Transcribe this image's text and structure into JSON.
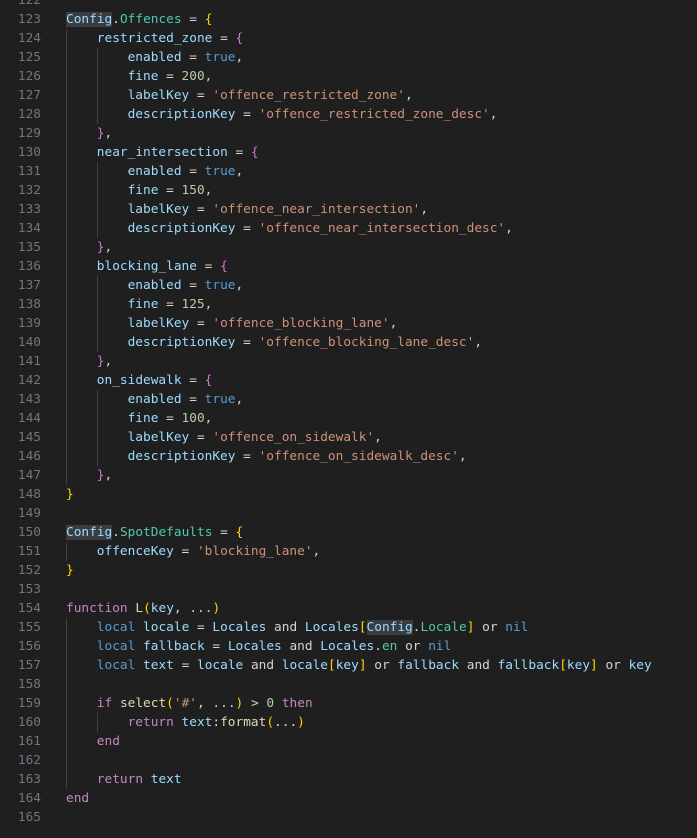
{
  "editor": {
    "language": "lua",
    "lines": [
      {
        "n": "122",
        "indent": 0,
        "tokens": []
      },
      {
        "n": "123",
        "indent": 0,
        "tokens": [
          [
            "vh",
            "Config"
          ],
          [
            "o",
            "."
          ],
          [
            "p",
            "Offences"
          ],
          [
            "o",
            " = "
          ],
          [
            "b1",
            "{"
          ]
        ]
      },
      {
        "n": "124",
        "indent": 1,
        "tokens": [
          [
            "v",
            "restricted_zone"
          ],
          [
            "o",
            " = "
          ],
          [
            "b2",
            "{"
          ]
        ]
      },
      {
        "n": "125",
        "indent": 2,
        "tokens": [
          [
            "v",
            "enabled"
          ],
          [
            "o",
            " = "
          ],
          [
            "k",
            "true"
          ],
          [
            "o",
            ","
          ]
        ]
      },
      {
        "n": "126",
        "indent": 2,
        "tokens": [
          [
            "v",
            "fine"
          ],
          [
            "o",
            " = "
          ],
          [
            "num",
            "200"
          ],
          [
            "o",
            ","
          ]
        ]
      },
      {
        "n": "127",
        "indent": 2,
        "tokens": [
          [
            "v",
            "labelKey"
          ],
          [
            "o",
            " = "
          ],
          [
            "s",
            "'offence_restricted_zone'"
          ],
          [
            "o",
            ","
          ]
        ]
      },
      {
        "n": "128",
        "indent": 2,
        "tokens": [
          [
            "v",
            "descriptionKey"
          ],
          [
            "o",
            " = "
          ],
          [
            "s",
            "'offence_restricted_zone_desc'"
          ],
          [
            "o",
            ","
          ]
        ]
      },
      {
        "n": "129",
        "indent": 1,
        "tokens": [
          [
            "b2",
            "}"
          ],
          [
            "o",
            ","
          ]
        ]
      },
      {
        "n": "130",
        "indent": 1,
        "tokens": [
          [
            "v",
            "near_intersection"
          ],
          [
            "o",
            " = "
          ],
          [
            "b2",
            "{"
          ]
        ]
      },
      {
        "n": "131",
        "indent": 2,
        "tokens": [
          [
            "v",
            "enabled"
          ],
          [
            "o",
            " = "
          ],
          [
            "k",
            "true"
          ],
          [
            "o",
            ","
          ]
        ]
      },
      {
        "n": "132",
        "indent": 2,
        "tokens": [
          [
            "v",
            "fine"
          ],
          [
            "o",
            " = "
          ],
          [
            "num",
            "150"
          ],
          [
            "o",
            ","
          ]
        ]
      },
      {
        "n": "133",
        "indent": 2,
        "tokens": [
          [
            "v",
            "labelKey"
          ],
          [
            "o",
            " = "
          ],
          [
            "s",
            "'offence_near_intersection'"
          ],
          [
            "o",
            ","
          ]
        ]
      },
      {
        "n": "134",
        "indent": 2,
        "tokens": [
          [
            "v",
            "descriptionKey"
          ],
          [
            "o",
            " = "
          ],
          [
            "s",
            "'offence_near_intersection_desc'"
          ],
          [
            "o",
            ","
          ]
        ]
      },
      {
        "n": "135",
        "indent": 1,
        "tokens": [
          [
            "b2",
            "}"
          ],
          [
            "o",
            ","
          ]
        ]
      },
      {
        "n": "136",
        "indent": 1,
        "tokens": [
          [
            "v",
            "blocking_lane"
          ],
          [
            "o",
            " = "
          ],
          [
            "b2",
            "{"
          ]
        ]
      },
      {
        "n": "137",
        "indent": 2,
        "tokens": [
          [
            "v",
            "enabled"
          ],
          [
            "o",
            " = "
          ],
          [
            "k",
            "true"
          ],
          [
            "o",
            ","
          ]
        ]
      },
      {
        "n": "138",
        "indent": 2,
        "tokens": [
          [
            "v",
            "fine"
          ],
          [
            "o",
            " = "
          ],
          [
            "num",
            "125"
          ],
          [
            "o",
            ","
          ]
        ]
      },
      {
        "n": "139",
        "indent": 2,
        "tokens": [
          [
            "v",
            "labelKey"
          ],
          [
            "o",
            " = "
          ],
          [
            "s",
            "'offence_blocking_lane'"
          ],
          [
            "o",
            ","
          ]
        ]
      },
      {
        "n": "140",
        "indent": 2,
        "tokens": [
          [
            "v",
            "descriptionKey"
          ],
          [
            "o",
            " = "
          ],
          [
            "s",
            "'offence_blocking_lane_desc'"
          ],
          [
            "o",
            ","
          ]
        ]
      },
      {
        "n": "141",
        "indent": 1,
        "tokens": [
          [
            "b2",
            "}"
          ],
          [
            "o",
            ","
          ]
        ]
      },
      {
        "n": "142",
        "indent": 1,
        "tokens": [
          [
            "v",
            "on_sidewalk"
          ],
          [
            "o",
            " = "
          ],
          [
            "b2",
            "{"
          ]
        ]
      },
      {
        "n": "143",
        "indent": 2,
        "tokens": [
          [
            "v",
            "enabled"
          ],
          [
            "o",
            " = "
          ],
          [
            "k",
            "true"
          ],
          [
            "o",
            ","
          ]
        ]
      },
      {
        "n": "144",
        "indent": 2,
        "tokens": [
          [
            "v",
            "fine"
          ],
          [
            "o",
            " = "
          ],
          [
            "num",
            "100"
          ],
          [
            "o",
            ","
          ]
        ]
      },
      {
        "n": "145",
        "indent": 2,
        "tokens": [
          [
            "v",
            "labelKey"
          ],
          [
            "o",
            " = "
          ],
          [
            "s",
            "'offence_on_sidewalk'"
          ],
          [
            "o",
            ","
          ]
        ]
      },
      {
        "n": "146",
        "indent": 2,
        "tokens": [
          [
            "v",
            "descriptionKey"
          ],
          [
            "o",
            " = "
          ],
          [
            "s",
            "'offence_on_sidewalk_desc'"
          ],
          [
            "o",
            ","
          ]
        ]
      },
      {
        "n": "147",
        "indent": 1,
        "tokens": [
          [
            "b2",
            "}"
          ],
          [
            "o",
            ","
          ]
        ]
      },
      {
        "n": "148",
        "indent": 0,
        "tokens": [
          [
            "b1",
            "}"
          ]
        ]
      },
      {
        "n": "149",
        "indent": 0,
        "tokens": []
      },
      {
        "n": "150",
        "indent": 0,
        "tokens": [
          [
            "vh",
            "Config"
          ],
          [
            "o",
            "."
          ],
          [
            "p",
            "SpotDefaults"
          ],
          [
            "o",
            " = "
          ],
          [
            "b1",
            "{"
          ]
        ]
      },
      {
        "n": "151",
        "indent": 1,
        "tokens": [
          [
            "v",
            "offenceKey"
          ],
          [
            "o",
            " = "
          ],
          [
            "s",
            "'blocking_lane'"
          ],
          [
            "o",
            ","
          ]
        ]
      },
      {
        "n": "152",
        "indent": 0,
        "tokens": [
          [
            "b1",
            "}"
          ]
        ]
      },
      {
        "n": "153",
        "indent": 0,
        "tokens": []
      },
      {
        "n": "154",
        "indent": 0,
        "tokens": [
          [
            "c",
            "function"
          ],
          [
            "o",
            " "
          ],
          [
            "f",
            "L"
          ],
          [
            "b1",
            "("
          ],
          [
            "v",
            "key"
          ],
          [
            "o",
            ", ..."
          ],
          [
            "b1",
            ")"
          ]
        ]
      },
      {
        "n": "155",
        "indent": 1,
        "tokens": [
          [
            "k",
            "local"
          ],
          [
            "o",
            " "
          ],
          [
            "v",
            "locale"
          ],
          [
            "o",
            " = "
          ],
          [
            "v",
            "Locales"
          ],
          [
            "o",
            " and "
          ],
          [
            "v",
            "Locales"
          ],
          [
            "b1",
            "["
          ],
          [
            "vh",
            "Config"
          ],
          [
            "o",
            "."
          ],
          [
            "p",
            "Locale"
          ],
          [
            "b1",
            "]"
          ],
          [
            "o",
            " or "
          ],
          [
            "k",
            "nil"
          ]
        ]
      },
      {
        "n": "156",
        "indent": 1,
        "tokens": [
          [
            "k",
            "local"
          ],
          [
            "o",
            " "
          ],
          [
            "v",
            "fallback"
          ],
          [
            "o",
            " = "
          ],
          [
            "v",
            "Locales"
          ],
          [
            "o",
            " and "
          ],
          [
            "v",
            "Locales"
          ],
          [
            "o",
            "."
          ],
          [
            "p",
            "en"
          ],
          [
            "o",
            " or "
          ],
          [
            "k",
            "nil"
          ]
        ]
      },
      {
        "n": "157",
        "indent": 1,
        "tokens": [
          [
            "k",
            "local"
          ],
          [
            "o",
            " "
          ],
          [
            "v",
            "text"
          ],
          [
            "o",
            " = "
          ],
          [
            "v",
            "locale"
          ],
          [
            "o",
            " and "
          ],
          [
            "v",
            "locale"
          ],
          [
            "b1",
            "["
          ],
          [
            "v",
            "key"
          ],
          [
            "b1",
            "]"
          ],
          [
            "o",
            " or "
          ],
          [
            "v",
            "fallback"
          ],
          [
            "o",
            " and "
          ],
          [
            "v",
            "fallback"
          ],
          [
            "b1",
            "["
          ],
          [
            "v",
            "key"
          ],
          [
            "b1",
            "]"
          ],
          [
            "o",
            " or "
          ],
          [
            "v",
            "key"
          ]
        ]
      },
      {
        "n": "158",
        "indent": 1,
        "tokens": []
      },
      {
        "n": "159",
        "indent": 1,
        "tokens": [
          [
            "c",
            "if"
          ],
          [
            "o",
            " "
          ],
          [
            "f",
            "select"
          ],
          [
            "b1",
            "("
          ],
          [
            "s",
            "'#'"
          ],
          [
            "o",
            ", ..."
          ],
          [
            "b1",
            ")"
          ],
          [
            "o",
            " > "
          ],
          [
            "num",
            "0"
          ],
          [
            "o",
            " "
          ],
          [
            "c",
            "then"
          ]
        ]
      },
      {
        "n": "160",
        "indent": 2,
        "tokens": [
          [
            "c",
            "return"
          ],
          [
            "o",
            " "
          ],
          [
            "v",
            "text"
          ],
          [
            "o",
            ":"
          ],
          [
            "f",
            "format"
          ],
          [
            "b1",
            "("
          ],
          [
            "o",
            "..."
          ],
          [
            "b1",
            ")"
          ]
        ]
      },
      {
        "n": "161",
        "indent": 1,
        "tokens": [
          [
            "c",
            "end"
          ]
        ]
      },
      {
        "n": "162",
        "indent": 1,
        "tokens": []
      },
      {
        "n": "163",
        "indent": 1,
        "tokens": [
          [
            "c",
            "return"
          ],
          [
            "o",
            " "
          ],
          [
            "v",
            "text"
          ]
        ]
      },
      {
        "n": "164",
        "indent": 0,
        "tokens": [
          [
            "c",
            "end"
          ]
        ]
      },
      {
        "n": "165",
        "indent": 0,
        "tokens": []
      }
    ]
  }
}
